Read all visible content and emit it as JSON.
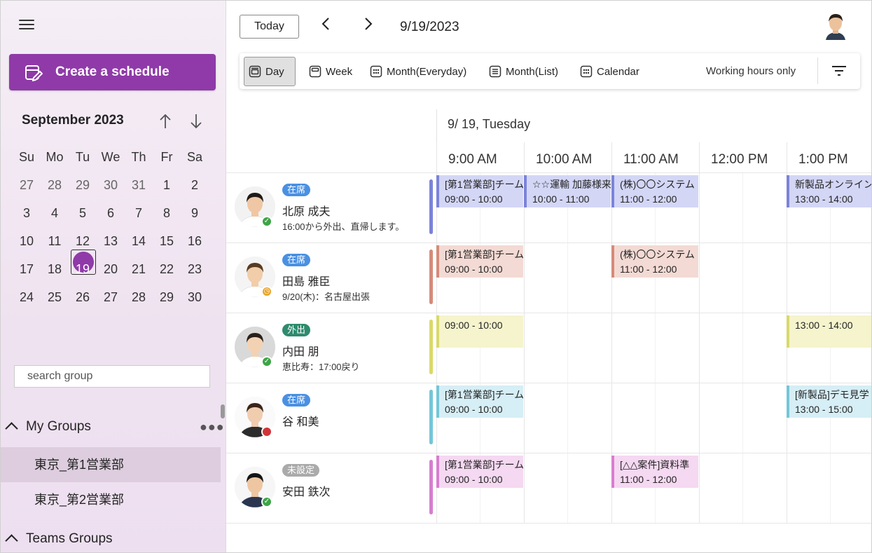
{
  "sidebar": {
    "create_label": "Create a schedule",
    "month_label": "September 2023",
    "weekdays": [
      "Su",
      "Mo",
      "Tu",
      "We",
      "Th",
      "Fr",
      "Sa"
    ],
    "weeks": [
      [
        "27",
        "28",
        "29",
        "30",
        "31",
        "1",
        "2"
      ],
      [
        "3",
        "4",
        "5",
        "6",
        "7",
        "8",
        "9"
      ],
      [
        "10",
        "11",
        "12",
        "13",
        "14",
        "15",
        "16"
      ],
      [
        "17",
        "18",
        "19",
        "20",
        "21",
        "22",
        "23"
      ],
      [
        "24",
        "25",
        "26",
        "27",
        "28",
        "29",
        "30"
      ]
    ],
    "selected_day": "19",
    "search_placeholder": "search group",
    "my_groups_label": "My Groups",
    "groups": [
      "東京_第1営業部",
      "東京_第2営業部"
    ],
    "teams_groups_label": "Teams Groups"
  },
  "header": {
    "today_label": "Today",
    "prev_icon": "‹",
    "next_icon": "›",
    "current_date": "9/19/2023"
  },
  "toolbar": {
    "views": [
      "Day",
      "Week",
      "Month(Everyday)",
      "Month(List)",
      "Calendar"
    ],
    "active_view": "Day",
    "working_hours_label": "Working hours only"
  },
  "schedule": {
    "day_label": "9/ 19, Tuesday",
    "hours": [
      "9:00 AM",
      "10:00 AM",
      "11:00 AM",
      "12:00 PM",
      "1:00 PM"
    ],
    "people": [
      {
        "status": "在席",
        "status_color": "#4a90e2",
        "name": "北原 成夫",
        "note": "16:00から外出、直帰します。",
        "presence": "available",
        "bar_color": "#7b83d9",
        "events": [
          {
            "title": "[第1営業部]チーム",
            "time": "09:00 - 10:00",
            "start": 9,
            "end": 10
          },
          {
            "title": "☆☆運輸 加藤様来",
            "time": "10:00 - 11:00",
            "start": 10,
            "end": 11
          },
          {
            "title": "(株)〇〇システム",
            "time": "11:00 - 12:00",
            "start": 11,
            "end": 12
          },
          {
            "title": "新製品オンライン",
            "time": "13:00 - 14:00",
            "start": 13,
            "end": 14
          }
        ]
      },
      {
        "status": "在席",
        "status_color": "#4a90e2",
        "name": "田島 雅臣",
        "note": "9/20(木)：名古屋出張",
        "presence": "away",
        "bar_color": "#d58a7a",
        "events": [
          {
            "title": "[第1営業部]チーム",
            "time": "09:00 - 10:00",
            "start": 9,
            "end": 10
          },
          {
            "title": "(株)〇〇システム",
            "time": "11:00 - 12:00",
            "start": 11,
            "end": 12
          }
        ]
      },
      {
        "status": "外出",
        "status_color": "#2e8b6e",
        "name": "内田 朋",
        "note": "恵比寿：17:00戻り",
        "presence": "available",
        "bar_color": "#d9d96a",
        "events": [
          {
            "title": "",
            "time": "09:00 - 10:00",
            "start": 9,
            "end": 10
          },
          {
            "title": "",
            "time": "13:00 - 14:00",
            "start": 13,
            "end": 14
          }
        ]
      },
      {
        "status": "在席",
        "status_color": "#4a90e2",
        "name": "谷 和美",
        "note": "",
        "presence": "busy",
        "bar_color": "#74c6d8",
        "events": [
          {
            "title": "[第1営業部]チーム",
            "time": "09:00 - 10:00",
            "start": 9,
            "end": 10
          },
          {
            "title": "[新製品]デモ見学",
            "time": "13:00 - 15:00",
            "start": 13,
            "end": 15
          }
        ]
      },
      {
        "status": "未設定",
        "status_color": "#aaaaaa",
        "name": "安田 鉄次",
        "note": "",
        "presence": "available",
        "bar_color": "#d77ecf",
        "events": [
          {
            "title": "[第1営業部]チーム",
            "time": "09:00 - 10:00",
            "start": 9,
            "end": 10
          },
          {
            "title": "[△△案件]資料準",
            "time": "11:00 - 12:00",
            "start": 11,
            "end": 12
          }
        ]
      }
    ]
  },
  "colors": {
    "accent": "#8f3aa8",
    "event_fills": [
      "#d3d6f5",
      "#f3dad4",
      "#f5f4cc",
      "#d6eef5",
      "#f5d8f1"
    ]
  }
}
